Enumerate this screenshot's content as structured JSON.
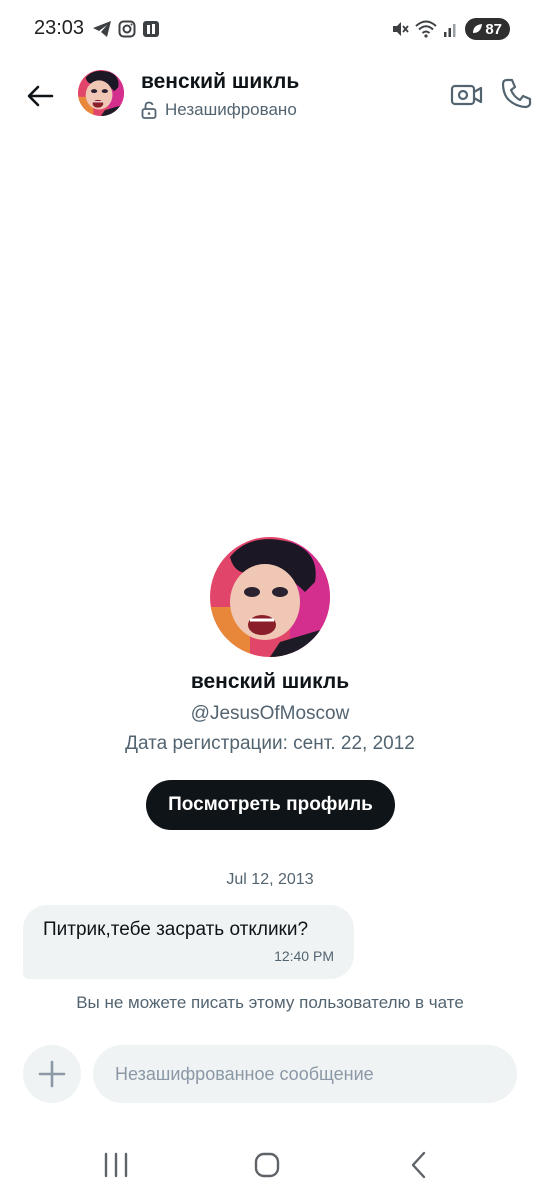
{
  "status": {
    "time": "23:03",
    "battery": "87",
    "left_icons": [
      "telegram-icon",
      "instagram-icon",
      "app-icon"
    ],
    "right_icons": [
      "mute-icon",
      "wifi-icon",
      "signal-icon",
      "battery-icon"
    ]
  },
  "header": {
    "name": "венский шикль",
    "encryption_status": "Незашифровано"
  },
  "profile": {
    "name": "венский шикль",
    "handle": "@JesusOfMoscow",
    "joined": "Дата регистрации: сент. 22, 2012",
    "view_profile_label": "Посмотреть профиль"
  },
  "messages": {
    "date": "Jul 12, 2013",
    "items": [
      {
        "text": "Питрик,тебе засрать отклики?",
        "time": "12:40 PM"
      }
    ],
    "notice": "Вы не можете писать этому пользователю в чате"
  },
  "composer": {
    "placeholder": "Незашифрованное сообщение"
  },
  "colors": {
    "text_primary": "#0f1419",
    "text_secondary": "#536471",
    "bubble_bg": "#eff3f4",
    "button_dark": "#0f1419"
  }
}
